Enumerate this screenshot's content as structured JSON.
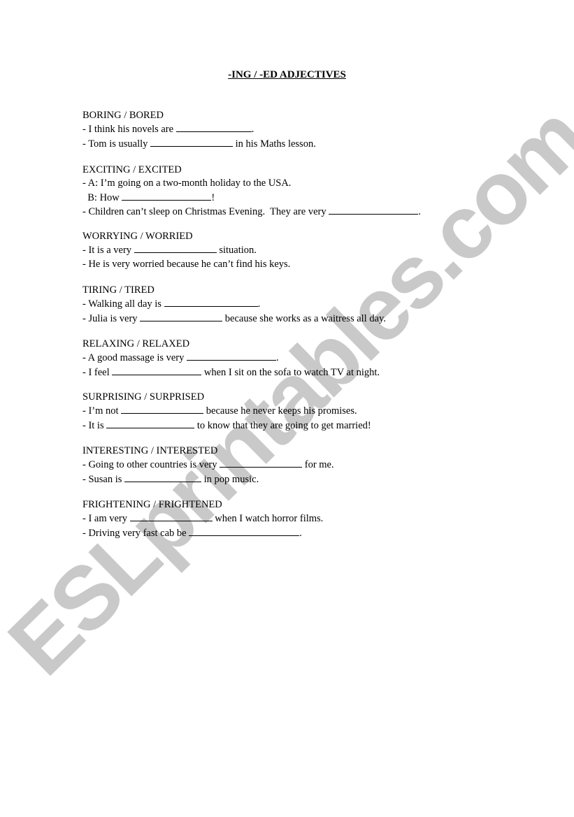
{
  "watermark": "ESLprintables.com",
  "title": "-ING / -ED ADJECTIVES",
  "sections": [
    {
      "heading": "BORING / BORED",
      "lines": [
        {
          "before": "- I think his novels are ",
          "after": "."
        },
        {
          "before": "- Tom is usually ",
          "after": " in his Maths lesson."
        }
      ]
    },
    {
      "heading": "EXCITING / EXCITED",
      "lines": [
        {
          "text": "- A: I’m going on a two-month holiday to the USA."
        },
        {
          "before": "  B: How ",
          "after": "!"
        },
        {
          "before": "- Children can’t sleep on Christmas Evening.  They are very ",
          "after": "."
        }
      ]
    },
    {
      "heading": "WORRYING / WORRIED",
      "lines": [
        {
          "before": "- It is a very ",
          "after": " situation."
        },
        {
          "text": "- He is very worried because he can’t find his keys."
        }
      ]
    },
    {
      "heading": "TIRING / TIRED",
      "lines": [
        {
          "before": "- Walking all day is ",
          "after": "."
        },
        {
          "before": "- Julia is very ",
          "after": " because she works as a waitress all day."
        }
      ]
    },
    {
      "heading": "RELAXING / RELAXED",
      "lines": [
        {
          "before": "- A good massage is very ",
          "after": "."
        },
        {
          "before": "- I feel ",
          "after": " when I sit on the sofa to watch TV at night."
        }
      ]
    },
    {
      "heading": "SURPRISING / SURPRISED",
      "lines": [
        {
          "before": "- I’m not ",
          "after": " because he never keeps his promises."
        },
        {
          "before": "- It is ",
          "after": " to know that they are going to get married!"
        }
      ]
    },
    {
      "heading": "INTERESTING / INTERESTED",
      "lines": [
        {
          "before": "- Going to other countries is very ",
          "after": " for me."
        },
        {
          "before": "- Susan is ",
          "after": " in pop music."
        }
      ]
    },
    {
      "heading": "FRIGHTENING / FRIGHTENED",
      "lines": [
        {
          "before": "- I am very ",
          "after": " when I watch horror films."
        },
        {
          "before": "- Driving very fast cab be ",
          "after": "."
        }
      ]
    }
  ]
}
